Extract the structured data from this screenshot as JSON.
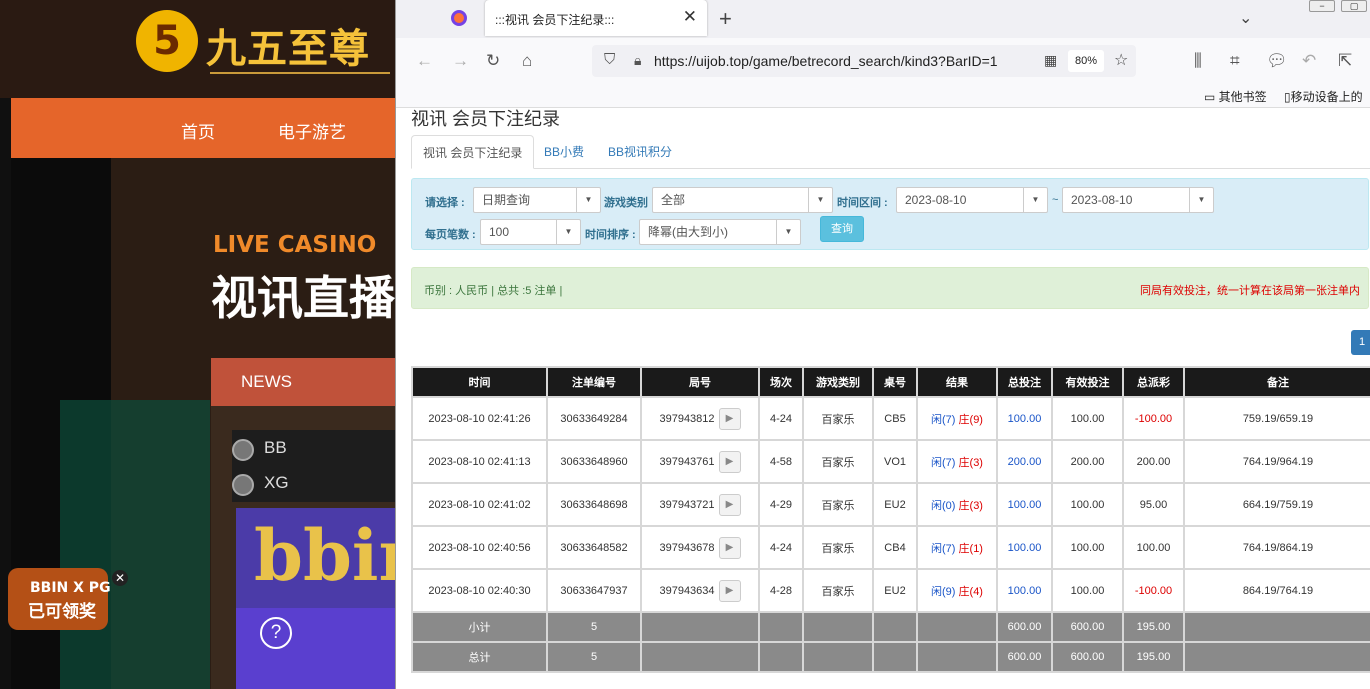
{
  "background": {
    "logo_digit": "5",
    "logo_text": "九五至尊",
    "nav": [
      "首页",
      "电子游艺"
    ],
    "live_label": "LIVE CASINO",
    "hero_title": "视讯直播",
    "news_label": "NEWS",
    "providers": [
      "BB",
      "XG"
    ],
    "bbin_text": "bbin",
    "help_icon": "?",
    "promo_line1": "BBIN X PG",
    "promo_line2": "已可领奖",
    "promo_close": "✕"
  },
  "browser": {
    "tab_title": ":::视讯 会员下注纪录:::",
    "url": "https://uijob.top/game/betrecord_search/kind3?BarID=1",
    "zoom": "80%",
    "bookmarks": [
      "其他书签",
      "移动设备上的"
    ]
  },
  "page": {
    "title": "视讯 会员下注纪录",
    "tabs": [
      "视讯 会员下注纪录",
      "BB小费",
      "BB视讯积分"
    ],
    "filter": {
      "select_label": "请选择 :",
      "query_type": "日期查询",
      "game_type_label": "游戏类别",
      "game_type": "全部",
      "time_range_label": "时间区间 :",
      "date_from": "2023-08-10",
      "date_sep": "~",
      "date_to": "2023-08-10",
      "per_page_label": "每页笔数 :",
      "per_page": "100",
      "sort_label": "时间排序 :",
      "sort": "降幂(由大到小)",
      "query_button": "查询"
    },
    "summary_left": "币别 : 人民币 | 总共 :5 注单 |",
    "summary_right": "同局有效投注，统一计算在该局第一张注单内",
    "page_number": "1",
    "table": {
      "headers": [
        "时间",
        "注单编号",
        "局号",
        "场次",
        "游戏类别",
        "桌号",
        "结果",
        "总投注",
        "有效投注",
        "总派彩",
        "备注"
      ],
      "rows": [
        {
          "time": "2023-08-10 02:41:26",
          "bet_id": "30633649284",
          "round": "397943812",
          "game": "4-24",
          "type": "百家乐",
          "table": "CB5",
          "r1": "闲(7)",
          "r2": "庄(9)",
          "bet": "100.00",
          "valid": "100.00",
          "payout": "-100.00",
          "note": "759.19/659.19"
        },
        {
          "time": "2023-08-10 02:41:13",
          "bet_id": "30633648960",
          "round": "397943761",
          "game": "4-58",
          "type": "百家乐",
          "table": "VO1",
          "r1": "闲(7)",
          "r2": "庄(3)",
          "bet": "200.00",
          "valid": "200.00",
          "payout": "200.00",
          "note": "764.19/964.19"
        },
        {
          "time": "2023-08-10 02:41:02",
          "bet_id": "30633648698",
          "round": "397943721",
          "game": "4-29",
          "type": "百家乐",
          "table": "EU2",
          "r1": "闲(0)",
          "r2": "庄(3)",
          "bet": "100.00",
          "valid": "100.00",
          "payout": "95.00",
          "note": "664.19/759.19"
        },
        {
          "time": "2023-08-10 02:40:56",
          "bet_id": "30633648582",
          "round": "397943678",
          "game": "4-24",
          "type": "百家乐",
          "table": "CB4",
          "r1": "闲(7)",
          "r2": "庄(1)",
          "bet": "100.00",
          "valid": "100.00",
          "payout": "100.00",
          "note": "764.19/864.19"
        },
        {
          "time": "2023-08-10 02:40:30",
          "bet_id": "30633647937",
          "round": "397943634",
          "game": "4-28",
          "type": "百家乐",
          "table": "EU2",
          "r1": "闲(9)",
          "r2": "庄(4)",
          "bet": "100.00",
          "valid": "100.00",
          "payout": "-100.00",
          "note": "864.19/764.19"
        }
      ],
      "subtotal": {
        "label": "小计",
        "count": "5",
        "bet": "600.00",
        "valid": "600.00",
        "payout": "195.00"
      },
      "total": {
        "label": "总计",
        "count": "5",
        "bet": "600.00",
        "valid": "600.00",
        "payout": "195.00"
      }
    }
  }
}
